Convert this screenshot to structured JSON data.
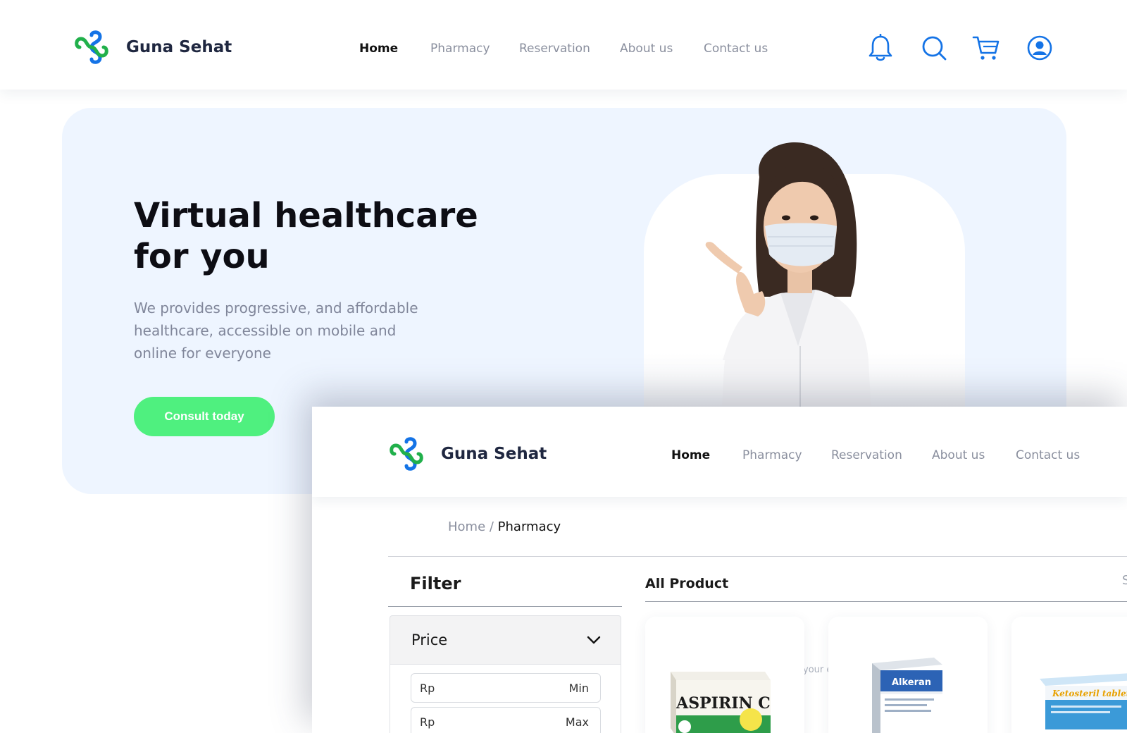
{
  "brand": {
    "name": "Guna Sehat",
    "colors": {
      "green": "#21b04b",
      "blue": "#1473e6"
    }
  },
  "nav": {
    "items": [
      {
        "label": "Home",
        "active": true
      },
      {
        "label": "Pharmacy"
      },
      {
        "label": "Reservation"
      },
      {
        "label": "About us"
      },
      {
        "label": "Contact us"
      }
    ],
    "icons": [
      "bell-icon",
      "search-icon",
      "cart-icon",
      "user-icon"
    ]
  },
  "hero": {
    "title_line1": "Virtual healthcare",
    "title_line2": "for you",
    "subtitle": "We provides progressive, and affordable healthcare, accessible on mobile and online for everyone",
    "cta_label": "Consult today",
    "cta_color": "#4ff07f"
  },
  "pharmacy": {
    "breadcrumb": {
      "root": "Home",
      "separator": " / ",
      "current": "Pharmacy"
    },
    "filter": {
      "title": "Filter",
      "price_label": "Price",
      "min": {
        "prefix": "Rp",
        "label": "Min"
      },
      "max": {
        "prefix": "Rp",
        "label": "Max"
      }
    },
    "products_title": "All Product",
    "ghost_text": "your e",
    "edge_text": "S",
    "products": [
      {
        "box_text": "ASPIRIN C"
      },
      {
        "box_text": "Alkeran"
      },
      {
        "box_text": "Ketosteril tablets"
      }
    ]
  }
}
